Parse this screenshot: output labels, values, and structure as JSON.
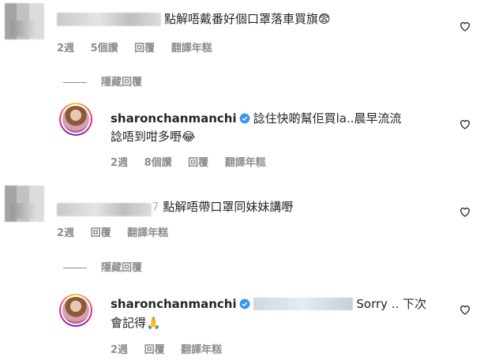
{
  "comments": [
    {
      "text": "點解唔戴番好個口罩落車買旗😨",
      "meta": {
        "age": "2週",
        "likes": "5個讚",
        "reply": "回覆",
        "translate": "翻譯年糕"
      }
    },
    {
      "hide_label": "隱藏回覆",
      "username": "sharonchanmanchi",
      "line1": "諗住快啲幫佢買la..晨早流流",
      "line2": "諗唔到咁多嘢😂",
      "meta": {
        "age": "2週",
        "likes": "8個讚",
        "reply": "回覆",
        "translate": "翻譯年糕"
      }
    },
    {
      "name_partial": "7",
      "text": "點解唔帶口罩同妹妹講嘢",
      "meta": {
        "age": "2週",
        "reply": "回覆",
        "translate": "翻譯年糕"
      }
    },
    {
      "hide_label": "隱藏回覆",
      "username": "sharonchanmanchi",
      "line1_suffix": "Sorry .. 下次",
      "line2": "會記得🙏",
      "meta": {
        "age": "2週",
        "reply": "回覆",
        "translate": "翻譯年糕"
      }
    }
  ],
  "colors": {
    "text": "#262626",
    "muted": "#8e8e8e",
    "verified": "#3897f0"
  },
  "icons": [
    "heart-icon",
    "verified-badge-icon"
  ]
}
